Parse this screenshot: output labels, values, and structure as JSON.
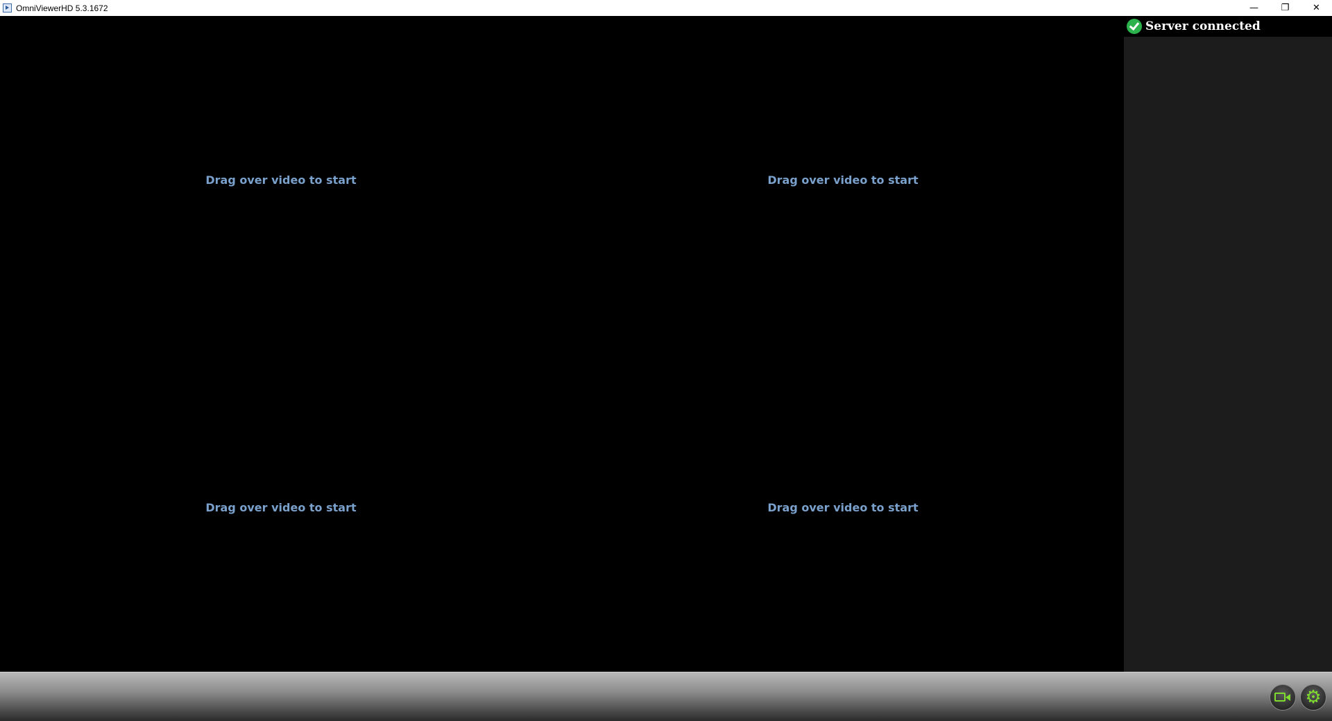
{
  "window": {
    "title": "OmniViewerHD 5.3.1672",
    "controls": {
      "minimize": "—",
      "restore": "❐",
      "close": "✕"
    }
  },
  "video_grid": {
    "cells": [
      {
        "hint": "Drag over video to start"
      },
      {
        "hint": "Drag over video to start"
      },
      {
        "hint": "Drag over video to start"
      },
      {
        "hint": "Drag over video to start"
      }
    ]
  },
  "side_panel": {
    "status_text": "Server connected",
    "status_icon": "check-circle-icon",
    "status_color": "#2bb24c"
  },
  "toolbar": {
    "buttons": [
      {
        "icon": "camera-icon"
      },
      {
        "icon": "gear-icon",
        "glyph": "⚙"
      }
    ],
    "accent_color": "#7fdc2e"
  },
  "colors": {
    "hint_text": "#7aa0cc",
    "background": "#000000",
    "panel": "#1c1c1c"
  }
}
